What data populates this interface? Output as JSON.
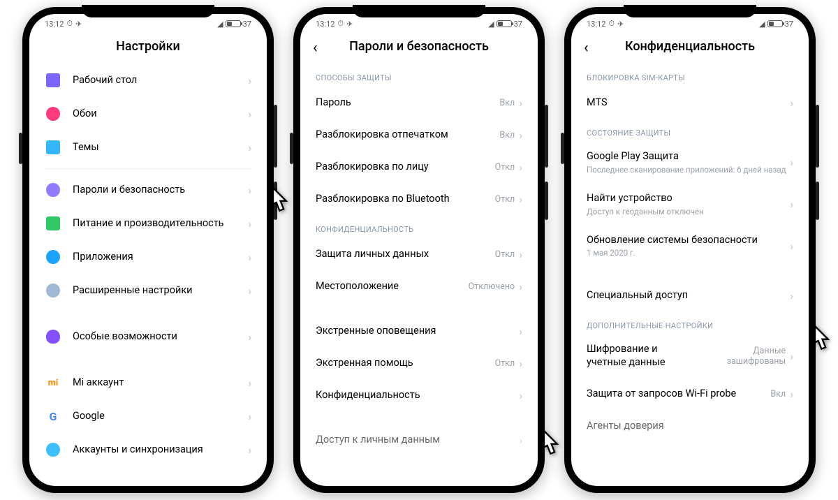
{
  "status": {
    "time": "13:12",
    "battery_pct": "37"
  },
  "phone1": {
    "title": "Настройки",
    "rows": [
      {
        "icon": "home",
        "color": "#7a66ff",
        "label": "Рабочий стол"
      },
      {
        "icon": "flower",
        "color": "#ff3a7a",
        "label": "Обои"
      },
      {
        "icon": "brush",
        "color": "#34b6ff",
        "label": "Темы"
      }
    ],
    "rows2": [
      {
        "icon": "shield",
        "color": "#8e7bff",
        "label": "Пароли и безопасность"
      },
      {
        "icon": "battery",
        "color": "#2fc968",
        "label": "Питание и производительность"
      },
      {
        "icon": "gear",
        "color": "#1aa3ff",
        "label": "Приложения"
      },
      {
        "icon": "dots",
        "color": "#9fb8d6",
        "label": "Расширенные настройки"
      }
    ],
    "rows3": [
      {
        "icon": "access",
        "color": "#8250ff",
        "label": "Особые возможности"
      }
    ],
    "rows4": [
      {
        "icon": "mi",
        "color": "#ff8a00",
        "label": "Mi аккаунт"
      },
      {
        "icon": "google",
        "color": "#4285f4",
        "label": "Google"
      },
      {
        "icon": "sync",
        "color": "#3cc0ff",
        "label": "Аккаунты и синхронизация"
      }
    ]
  },
  "phone2": {
    "title": "Пароли и безопасность",
    "sec1_label": "СПОСОБЫ ЗАЩИТЫ",
    "sec1": [
      {
        "label": "Пароль",
        "value": "Вкл"
      },
      {
        "label": "Разблокировка отпечатком",
        "value": "Вкл"
      },
      {
        "label": "Разблокировка по лицу",
        "value": "Откл"
      },
      {
        "label": "Разблокировка по Bluetooth",
        "value": "Откл"
      }
    ],
    "sec2_label": "КОНФИДЕНЦИАЛЬНОСТЬ",
    "sec2": [
      {
        "label": "Защита личных данных",
        "value": "Откл"
      },
      {
        "label": "Местоположение",
        "value": "Отключено"
      }
    ],
    "sec3": [
      {
        "label": "Экстренные оповещения",
        "value": ""
      },
      {
        "label": "Экстренная помощь",
        "value": "Откл"
      },
      {
        "label": "Конфиденциальность",
        "value": ""
      }
    ],
    "cut": "Доступ к личным данным"
  },
  "phone3": {
    "title": "Конфиденциальность",
    "sec1_label": "БЛОКИРОВКА SIM-КАРТЫ",
    "sec1": [
      {
        "label": "MTS"
      }
    ],
    "sec2_label": "СОСТОЯНИЕ ЗАЩИТЫ",
    "sec2": [
      {
        "label": "Google Play Защита",
        "sub": "Последнее сканирование приложений: 6 дней назад"
      },
      {
        "label": "Найти устройство",
        "sub": "Доступ к геоданным отключен"
      },
      {
        "label": "Обновление системы безопасности",
        "sub": "1 мая 2020 г."
      }
    ],
    "special": "Специальный доступ",
    "sec3_label": "ДОПОЛНИТЕЛЬНЫЕ НАСТРОЙКИ",
    "sec3": [
      {
        "label": "Шифрование и учетные данные",
        "value": "Данные зашифрованы"
      },
      {
        "label": "Защита от запросов Wi-Fi probe",
        "value": "Вкл"
      }
    ],
    "cut": "Агенты доверия"
  }
}
